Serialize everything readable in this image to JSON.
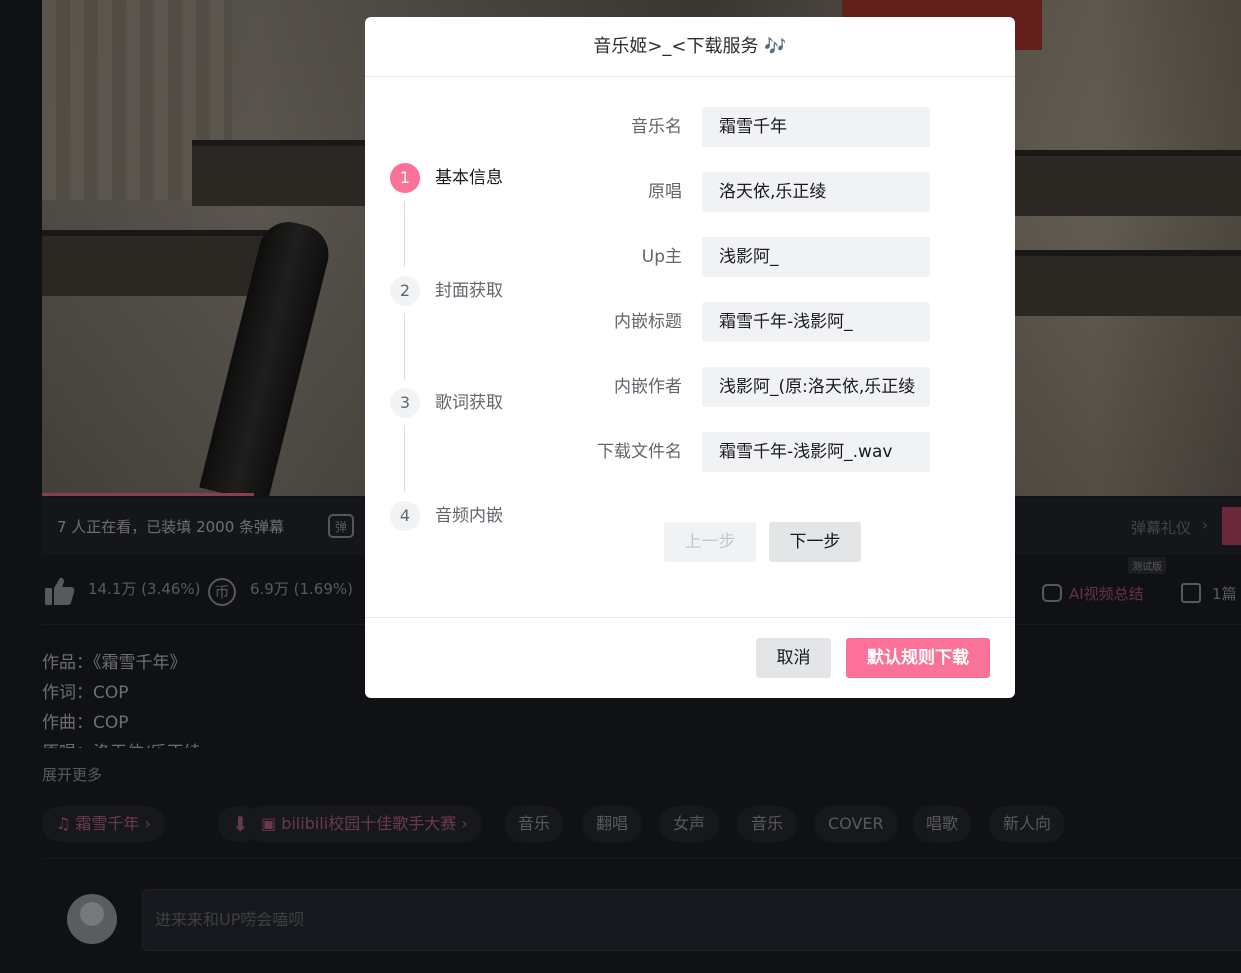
{
  "background": {
    "watching_text": "7 人正在看，已装填 2000 条弹幕",
    "danmaku_toggle_glyph": "弹",
    "danmaku_gift": "弹幕礼仪",
    "danmaku_gift_arrow": "›",
    "like_count": "14.1万 (3.46%)",
    "coin_symbol": "币",
    "coin_count": "6.9万 (1.69%)",
    "ai_badge": "测试版",
    "ai_summary": "AI视频总结",
    "notes": "1篇",
    "description_lines": [
      "作品：《霜雪千年》",
      "作词：COP",
      "作曲：COP",
      "原唱：洛天依/乐正绫"
    ],
    "expand_more": "展开更多",
    "tags": [
      {
        "label": "♫ 霜雪千年 ›",
        "icon": "music-note-icon"
      },
      {
        "label": "⬇",
        "icon": "download-icon"
      },
      {
        "label": "▣ bilibili校园十佳歌手大赛 ›",
        "icon": "tv-icon"
      },
      {
        "label": "音乐"
      },
      {
        "label": "翻唱"
      },
      {
        "label": "女声"
      },
      {
        "label": "音乐"
      },
      {
        "label": "COVER"
      },
      {
        "label": "唱歌"
      },
      {
        "label": "新人向"
      }
    ],
    "comment_placeholder": "进来来和UP唠会嗑呗",
    "accent_color": "#fb7299"
  },
  "modal": {
    "title": "音乐姬>_<下载服务 🎶",
    "steps": [
      {
        "number": "1",
        "label": "基本信息",
        "active": true
      },
      {
        "number": "2",
        "label": "封面获取",
        "active": false
      },
      {
        "number": "3",
        "label": "歌词获取",
        "active": false
      },
      {
        "number": "4",
        "label": "音频内嵌",
        "active": false
      }
    ],
    "fields": [
      {
        "label": "音乐名",
        "value": "霜雪千年"
      },
      {
        "label": "原唱",
        "value": "洛天依,乐正绫"
      },
      {
        "label": "Up主",
        "value": "浅影阿_"
      },
      {
        "label": "内嵌标题",
        "value": "霜雪千年-浅影阿_"
      },
      {
        "label": "内嵌作者",
        "value": "浅影阿_(原:洛天依,乐正绫"
      },
      {
        "label": "下载文件名",
        "value": "霜雪千年-浅影阿_.wav"
      }
    ],
    "prev_button": "上一步",
    "next_button": "下一步",
    "cancel_button": "取消",
    "download_button": "默认规则下载"
  }
}
